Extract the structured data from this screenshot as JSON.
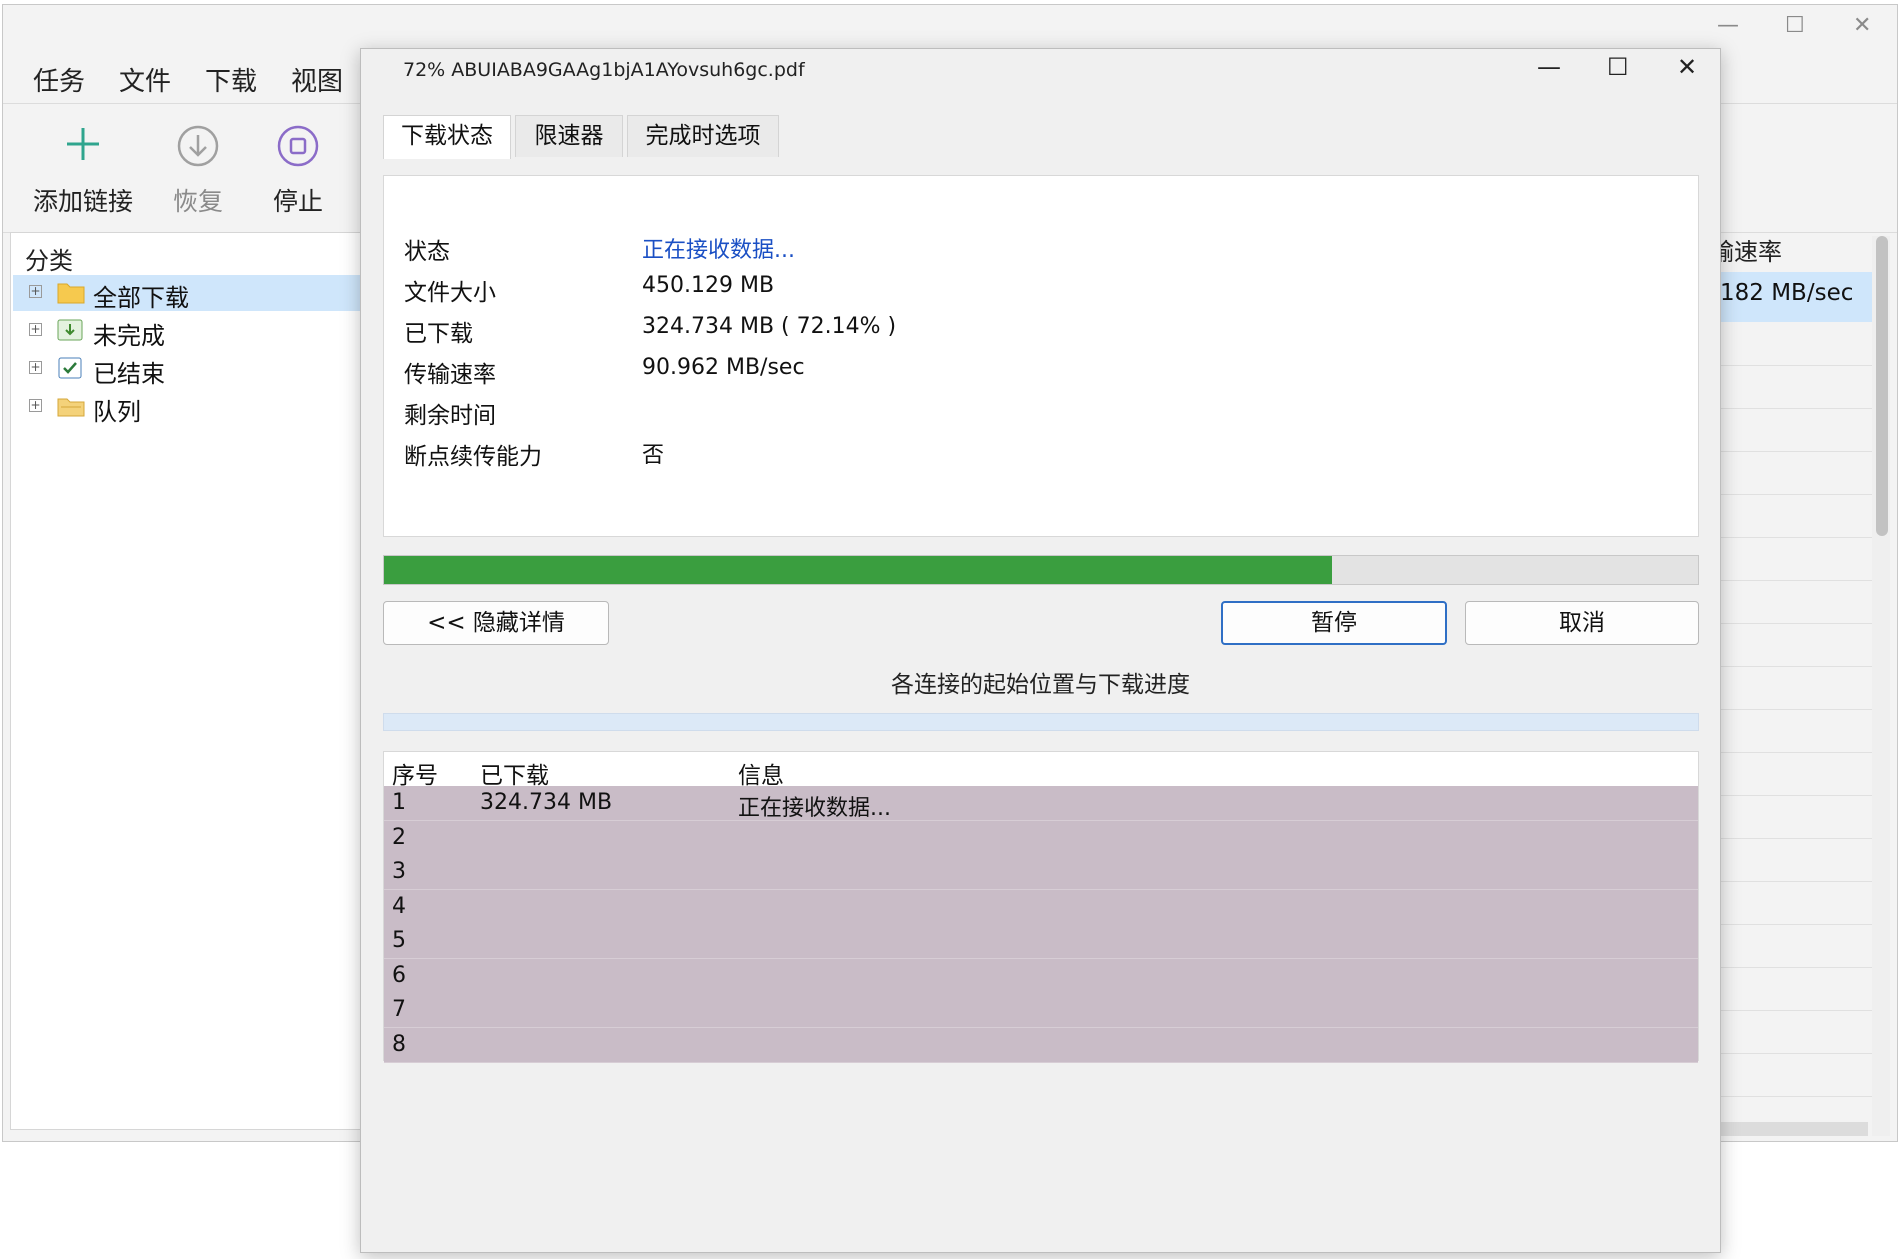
{
  "main_window": {
    "controls": {
      "minimize": "—",
      "maximize": "☐",
      "close": "✕"
    },
    "menu": [
      "任务",
      "文件",
      "下载",
      "视图"
    ],
    "toolbar": {
      "add": "添加链接",
      "resume": "恢复",
      "stop": "停止"
    },
    "sidebar": {
      "header": "分类",
      "items": [
        {
          "label": "全部下载",
          "icon": "folder-icon"
        },
        {
          "label": "未完成",
          "icon": "download-pending-icon"
        },
        {
          "label": "已结束",
          "icon": "checkbox-icon"
        },
        {
          "label": "队列",
          "icon": "folder-queue-icon"
        }
      ]
    },
    "right_column": {
      "header": "输速率",
      "selected_value": "182 MB/sec"
    }
  },
  "dialog": {
    "title": "72% ABUIABA9GAAg1bjA1AYovsuh6gc.pdf",
    "controls": {
      "minimize": "—",
      "maximize": "☐",
      "close": "✕"
    },
    "tabs": [
      "下载状态",
      "限速器",
      "完成时选项"
    ],
    "info": [
      {
        "label": "状态",
        "value": "正在接收数据..."
      },
      {
        "label": "文件大小",
        "value": "450.129 MB"
      },
      {
        "label": "已下载",
        "value": "324.734 MB ( 72.14% )"
      },
      {
        "label": "传输速率",
        "value": "90.962 MB/sec"
      },
      {
        "label": "剩余时间",
        "value": ""
      },
      {
        "label": "断点续传能力",
        "value": "否"
      }
    ],
    "progress_percent": 72.14,
    "progress_color": "#3a9e3f",
    "buttons": {
      "hide_details": "<< 隐藏详情",
      "pause": "暂停",
      "cancel": "取消"
    },
    "connections_caption": "各连接的起始位置与下载进度",
    "table": {
      "headers": [
        "序号",
        "已下载",
        "信息"
      ],
      "rows": [
        [
          "1",
          "324.734 MB",
          "正在接收数据..."
        ],
        [
          "2",
          "",
          ""
        ],
        [
          "3",
          "",
          ""
        ],
        [
          "4",
          "",
          ""
        ],
        [
          "5",
          "",
          ""
        ],
        [
          "6",
          "",
          ""
        ],
        [
          "7",
          "",
          ""
        ],
        [
          "8",
          "",
          ""
        ]
      ]
    }
  }
}
